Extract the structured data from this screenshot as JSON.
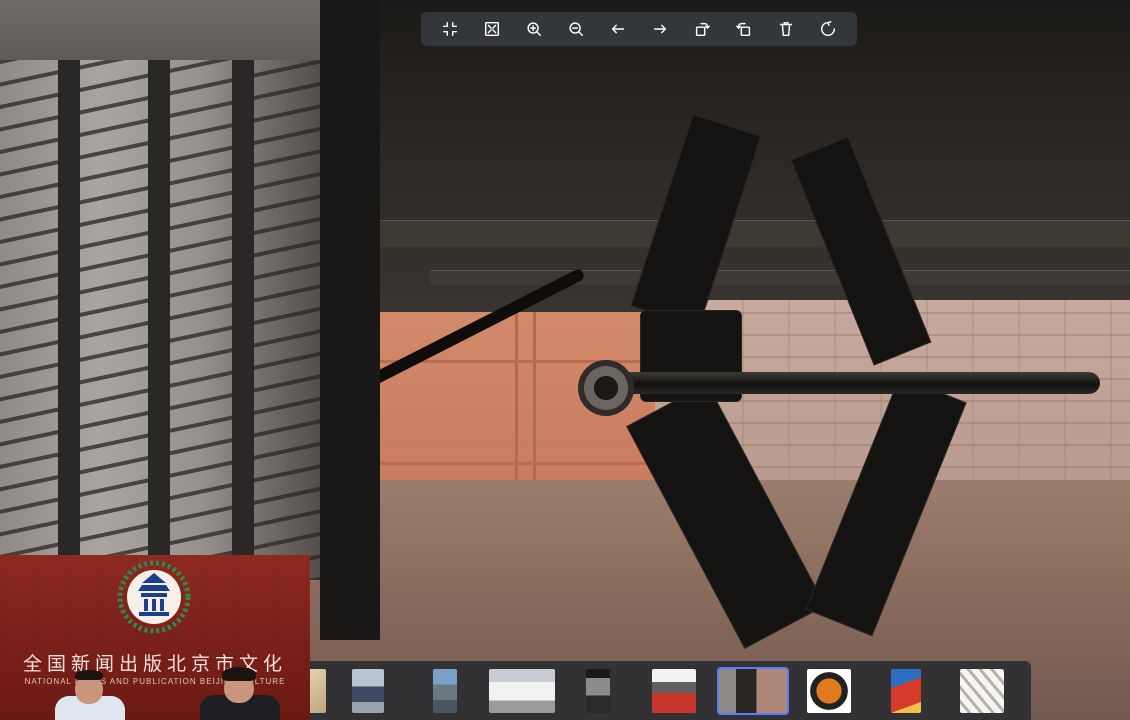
{
  "toolbar": {
    "buttons": [
      {
        "name": "exit-fullscreen-icon",
        "label": "Exit fullscreen"
      },
      {
        "name": "fit-screen-icon",
        "label": "Fit to screen"
      },
      {
        "name": "zoom-in-icon",
        "label": "Zoom in"
      },
      {
        "name": "zoom-out-icon",
        "label": "Zoom out"
      },
      {
        "name": "arrow-left-icon",
        "label": "Previous"
      },
      {
        "name": "arrow-right-icon",
        "label": "Next"
      },
      {
        "name": "rotate-right-icon",
        "label": "Rotate right"
      },
      {
        "name": "rotate-left-icon",
        "label": "Rotate left"
      },
      {
        "name": "trash-icon",
        "label": "Delete"
      },
      {
        "name": "reset-icon",
        "label": "Reset"
      }
    ]
  },
  "thumbnails": {
    "active_index": 7,
    "items": [
      {
        "name": "thumbnail-partial",
        "color": "#d9c7a8"
      },
      {
        "name": "thumbnail-suv-dark",
        "color": "#5e6f86"
      },
      {
        "name": "thumbnail-street-car",
        "color": "#8aa0b2"
      },
      {
        "name": "thumbnail-white-suv",
        "color": "#dedede"
      },
      {
        "name": "thumbnail-car-dark",
        "color": "#3a3a3a"
      },
      {
        "name": "thumbnail-jack-red",
        "color": "#b8352c"
      },
      {
        "name": "thumbnail-undercar-jack",
        "color": "#5a4a40"
      },
      {
        "name": "thumbnail-compressor",
        "color": "#e07a1e"
      },
      {
        "name": "thumbnail-red-box",
        "color": "#c8352a"
      },
      {
        "name": "thumbnail-tools",
        "color": "#efefef"
      }
    ]
  },
  "video": {
    "org_cn": "全国新闻出版北京市文化",
    "org_en": "NATIONAL PRESS AND PUBLICATION BEIJING CULTURE"
  },
  "colors": {
    "toolbar_bg": "#373a40",
    "active_thumb_border": "#5b7cff",
    "video_bg": "#7a2018"
  }
}
